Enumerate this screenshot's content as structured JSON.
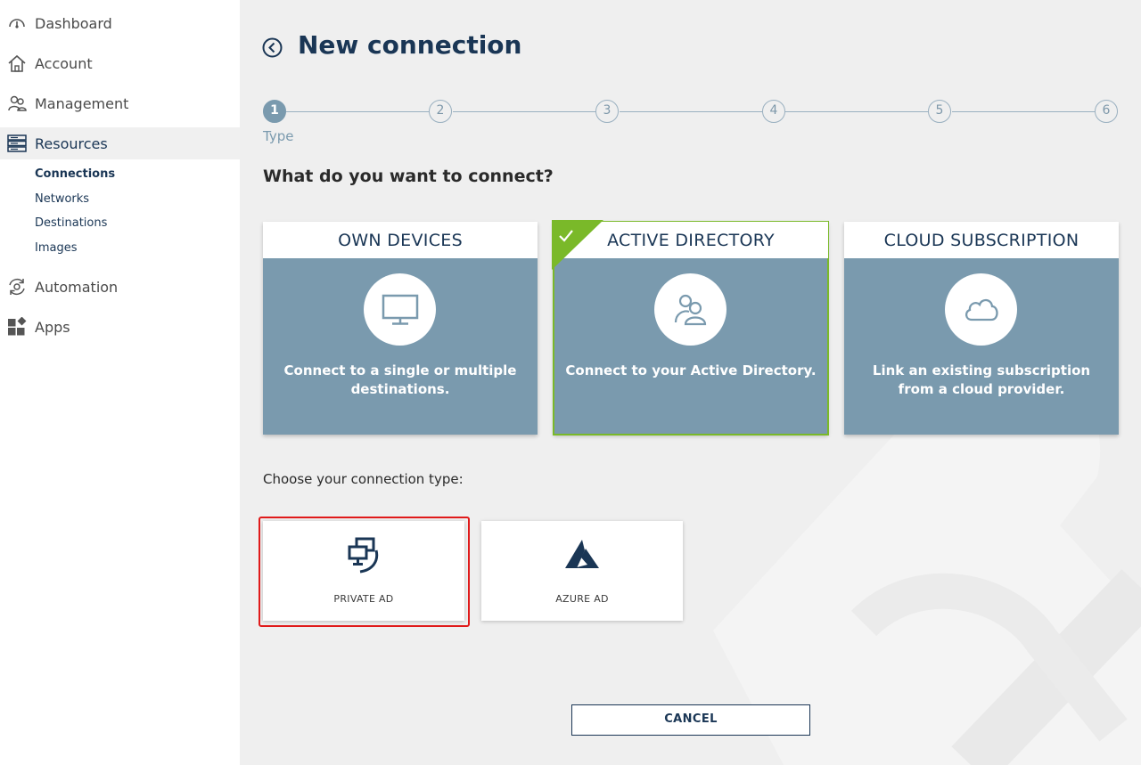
{
  "sidebar": {
    "items": [
      {
        "label": "Dashboard",
        "icon": "gauge-icon"
      },
      {
        "label": "Account",
        "icon": "home-icon"
      },
      {
        "label": "Management",
        "icon": "users-icon"
      },
      {
        "label": "Resources",
        "icon": "server-icon"
      },
      {
        "label": "Automation",
        "icon": "gear-cycle-icon"
      },
      {
        "label": "Apps",
        "icon": "apps-grid-icon"
      }
    ],
    "sub_items": [
      "Connections",
      "Networks",
      "Destinations",
      "Images"
    ]
  },
  "header": {
    "title": "New connection"
  },
  "stepper": {
    "steps": [
      "1",
      "2",
      "3",
      "4",
      "5",
      "6"
    ],
    "active_step": 1,
    "active_label": "Type"
  },
  "question": "What do you want to connect?",
  "cards": [
    {
      "title": "OWN DEVICES",
      "desc": "Connect to a single or multiple destinations.",
      "icon": "monitor-icon"
    },
    {
      "title": "ACTIVE DIRECTORY",
      "desc": "Connect to your Active Directory.",
      "icon": "users-icon"
    },
    {
      "title": "CLOUD SUBSCRIPTION",
      "desc": "Link an existing subscription from a cloud provider.",
      "icon": "cloud-icon"
    }
  ],
  "selected_card": "ACTIVE DIRECTORY",
  "choose_label": "Choose your connection type:",
  "connection_types": [
    {
      "label": "PRIVATE AD",
      "icon": "private-ad-icon"
    },
    {
      "label": "AZURE AD",
      "icon": "azure-icon"
    }
  ],
  "cancel_label": "CANCEL",
  "colors": {
    "navy": "#1a3655",
    "card_blue": "#7a9aae",
    "check_green": "#7ab929",
    "highlight_red": "#e01a1a"
  }
}
